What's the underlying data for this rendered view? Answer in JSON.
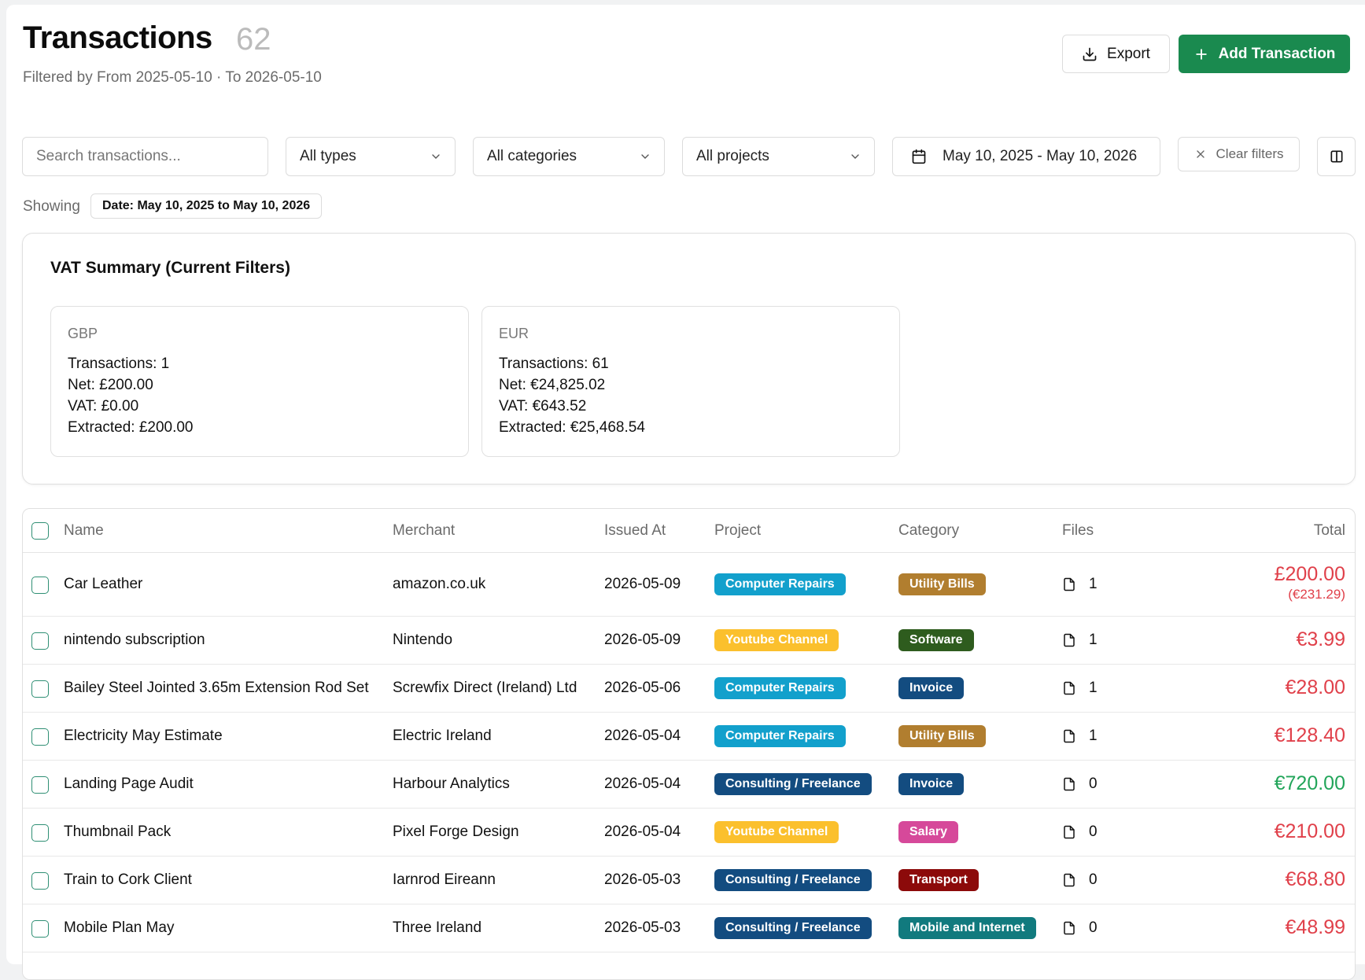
{
  "header": {
    "title": "Transactions",
    "count": "62",
    "subtitle": "Filtered by From 2025-05-10 · To 2026-05-10",
    "export_label": "Export",
    "add_label": "Add Transaction"
  },
  "filters": {
    "search_placeholder": "Search transactions...",
    "types": "All types",
    "categories": "All categories",
    "projects": "All projects",
    "date_range": "May 10, 2025 - May 10, 2026",
    "clear_label": "Clear filters"
  },
  "showing": {
    "label": "Showing",
    "chip": "Date: May 10, 2025 to May 10, 2026"
  },
  "vat": {
    "title": "VAT Summary (Current Filters)",
    "cards": [
      {
        "currency": "GBP",
        "transactions": "Transactions: 1",
        "net": "Net: £200.00",
        "vat": "VAT: £0.00",
        "extracted": "Extracted: £200.00"
      },
      {
        "currency": "EUR",
        "transactions": "Transactions: 61",
        "net": "Net: €24,825.02",
        "vat": "VAT: €643.52",
        "extracted": "Extracted: €25,468.54"
      }
    ]
  },
  "table": {
    "headers": {
      "name": "Name",
      "merchant": "Merchant",
      "issued": "Issued At",
      "project": "Project",
      "category": "Category",
      "files": "Files",
      "total": "Total"
    },
    "rows": [
      {
        "name": "Car Leather",
        "merchant": "amazon.co.uk",
        "issued": "2026-05-09",
        "project": "Computer Repairs",
        "project_color": "#12a0cc",
        "category": "Utility Bills",
        "category_color": "#b17e2f",
        "files": "1",
        "total": "£200.00",
        "total_sub": "(€231.29)",
        "total_color": "#e0404a"
      },
      {
        "name": "nintendo subscription",
        "merchant": "Nintendo",
        "issued": "2026-05-09",
        "project": "Youtube Channel",
        "project_color": "#fbc02d",
        "category": "Software",
        "category_color": "#2e5c1e",
        "files": "1",
        "total": "€3.99",
        "total_sub": "",
        "total_color": "#e0404a"
      },
      {
        "name": "Bailey Steel Jointed 3.65m Extension Rod Set",
        "merchant": "Screwfix Direct (Ireland) Ltd",
        "issued": "2026-05-06",
        "project": "Computer Repairs",
        "project_color": "#12a0cc",
        "category": "Invoice",
        "category_color": "#134c80",
        "files": "1",
        "total": "€28.00",
        "total_sub": "",
        "total_color": "#e0404a"
      },
      {
        "name": "Electricity May Estimate",
        "merchant": "Electric Ireland",
        "issued": "2026-05-04",
        "project": "Computer Repairs",
        "project_color": "#12a0cc",
        "category": "Utility Bills",
        "category_color": "#b17e2f",
        "files": "1",
        "total": "€128.40",
        "total_sub": "",
        "total_color": "#e0404a"
      },
      {
        "name": "Landing Page Audit",
        "merchant": "Harbour Analytics",
        "issued": "2026-05-04",
        "project": "Consulting / Freelance",
        "project_color": "#134c80",
        "category": "Invoice",
        "category_color": "#134c80",
        "files": "0",
        "total": "€720.00",
        "total_sub": "",
        "total_color": "#22a55a"
      },
      {
        "name": "Thumbnail Pack",
        "merchant": "Pixel Forge Design",
        "issued": "2026-05-04",
        "project": "Youtube Channel",
        "project_color": "#fbc02d",
        "category": "Salary",
        "category_color": "#d6499a",
        "files": "0",
        "total": "€210.00",
        "total_sub": "",
        "total_color": "#e0404a"
      },
      {
        "name": "Train to Cork Client",
        "merchant": "Iarnrod Eireann",
        "issued": "2026-05-03",
        "project": "Consulting / Freelance",
        "project_color": "#134c80",
        "category": "Transport",
        "category_color": "#8c0a0a",
        "files": "0",
        "total": "€68.80",
        "total_sub": "",
        "total_color": "#e0404a"
      },
      {
        "name": "Mobile Plan May",
        "merchant": "Three Ireland",
        "issued": "2026-05-03",
        "project": "Consulting / Freelance",
        "project_color": "#134c80",
        "category": "Mobile and Internet",
        "category_color": "#117a7e",
        "files": "0",
        "total": "€48.99",
        "total_sub": "",
        "total_color": "#e0404a"
      }
    ]
  }
}
